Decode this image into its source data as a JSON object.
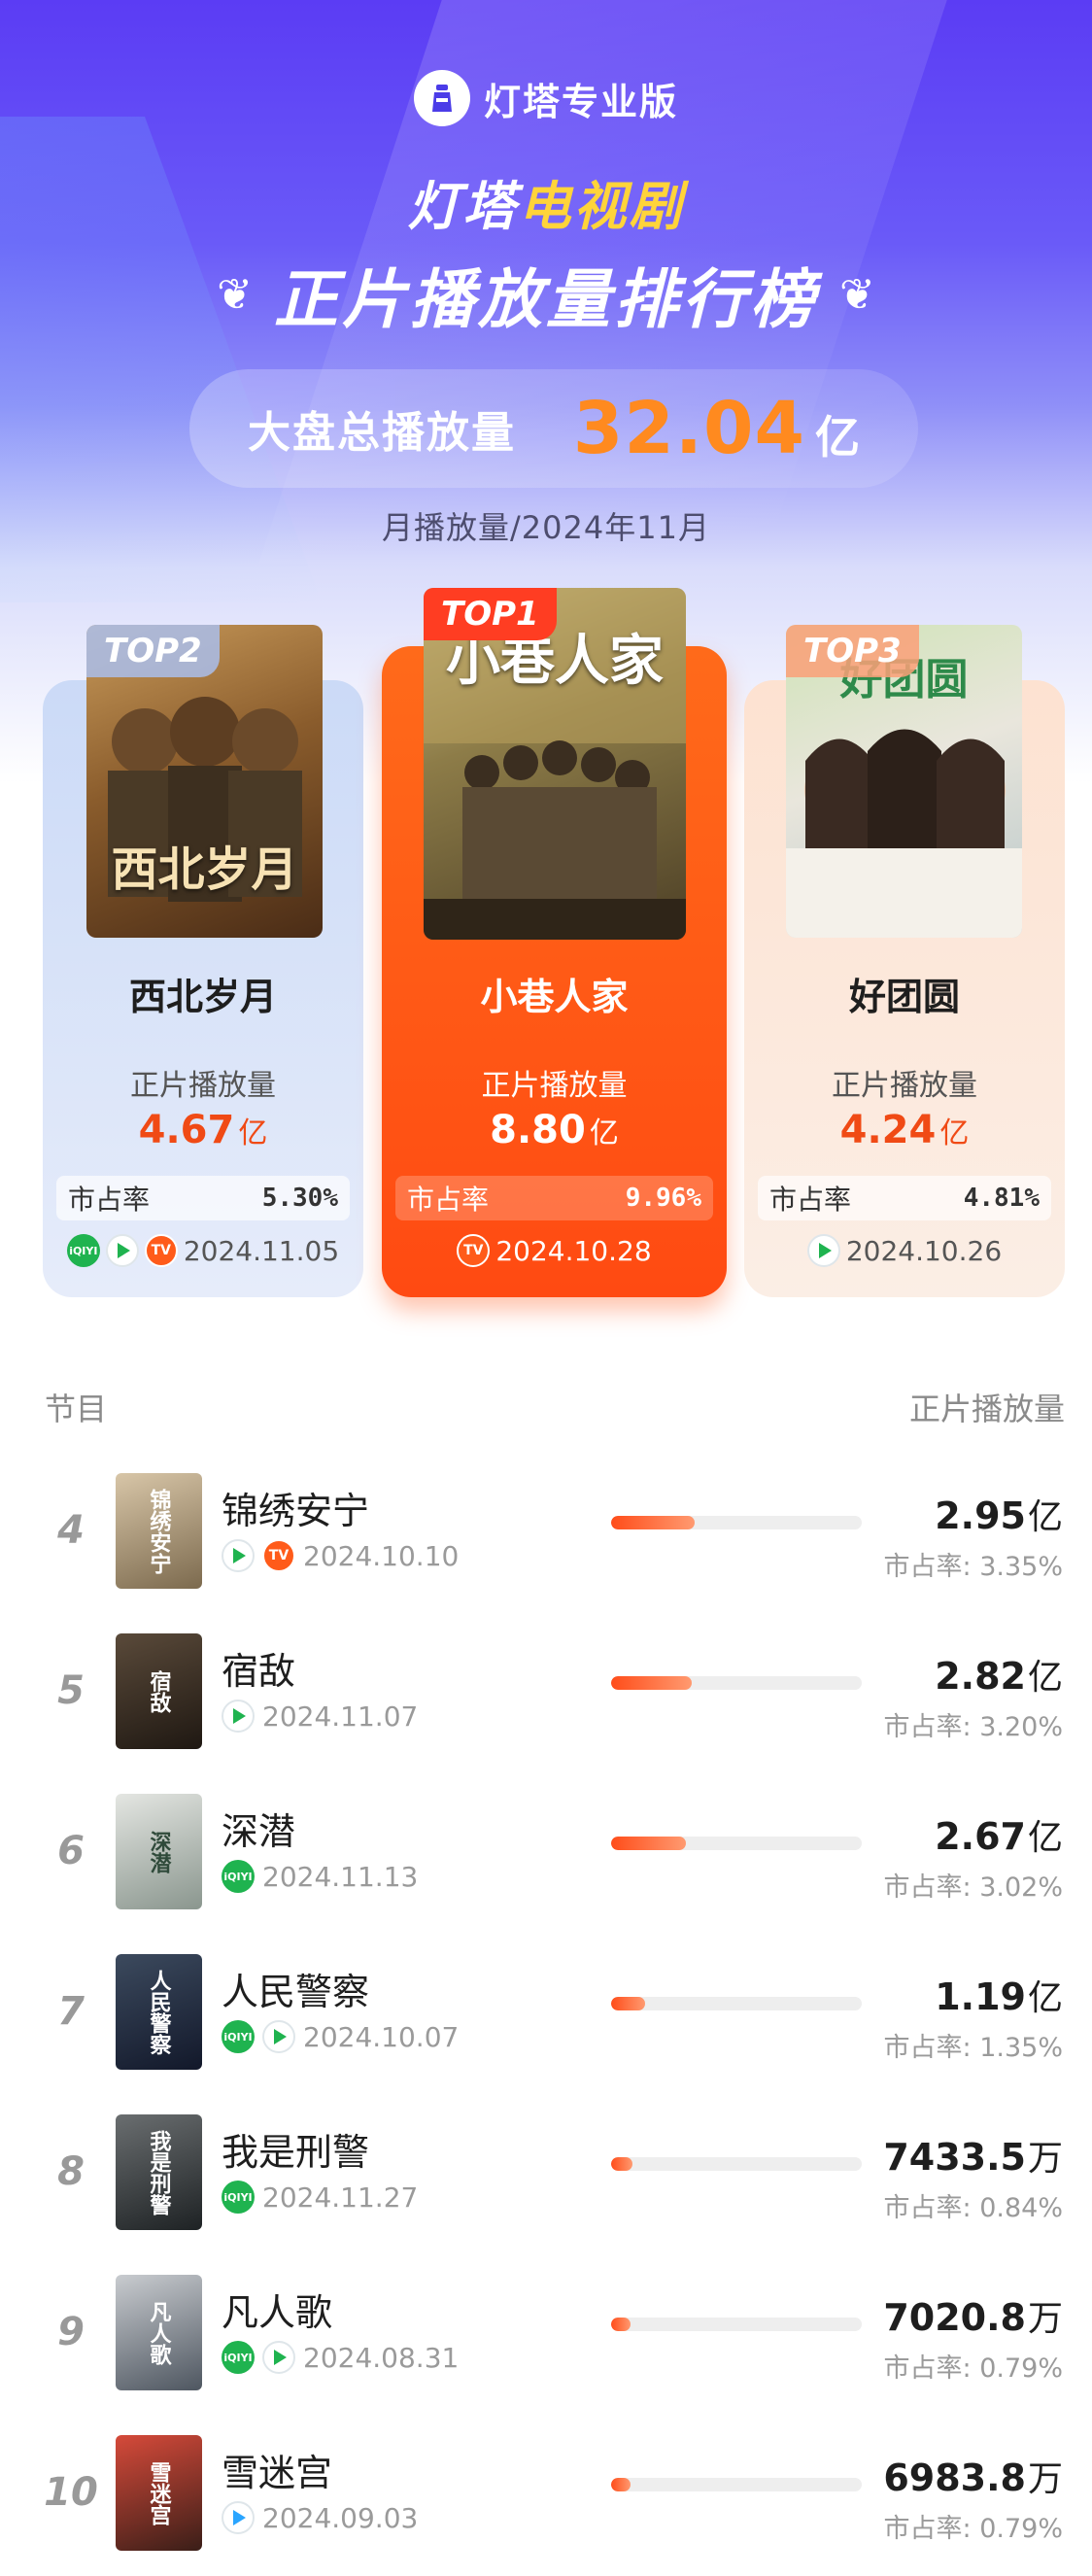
{
  "brand": {
    "name": "灯塔专业版"
  },
  "title": {
    "part1": "灯塔",
    "accent": "电视剧",
    "line2": "正片播放量排行榜"
  },
  "total": {
    "label": "大盘总播放量",
    "value": "32.04",
    "unit": "亿"
  },
  "subtitle": "月播放量/2024年11月",
  "top3": [
    {
      "badge": "TOP2",
      "name": "西北岁月",
      "poster_text": "西北岁月",
      "metric_label": "正片播放量",
      "value": "4.67",
      "unit": "亿",
      "share_label": "市占率",
      "share": "5.30%",
      "platforms": [
        "iqiyi",
        "tencent",
        "mgtv"
      ],
      "date": "2024.11.05"
    },
    {
      "badge": "TOP1",
      "name": "小巷人家",
      "poster_text": "小巷人家",
      "metric_label": "正片播放量",
      "value": "8.80",
      "unit": "亿",
      "share_label": "市占率",
      "share": "9.96%",
      "platforms": [
        "mgtv"
      ],
      "date": "2024.10.28"
    },
    {
      "badge": "TOP3",
      "name": "好团圆",
      "poster_text": "好团圆",
      "metric_label": "正片播放量",
      "value": "4.24",
      "unit": "亿",
      "share_label": "市占率",
      "share": "4.81%",
      "platforms": [
        "tencent"
      ],
      "date": "2024.10.26"
    }
  ],
  "list": {
    "col_program": "节目",
    "col_metric": "正片播放量",
    "rows": [
      {
        "rank": "4",
        "name": "锦绣安宁",
        "thumb_text": "锦绣安宁",
        "platforms": [
          "tencent",
          "mgtv"
        ],
        "date": "2024.10.10",
        "value": "2.95",
        "unit": "亿",
        "share": "市占率: 3.35%",
        "bar": 0.335
      },
      {
        "rank": "5",
        "name": "宿敌",
        "thumb_text": "宿敌",
        "platforms": [
          "tencent"
        ],
        "date": "2024.11.07",
        "value": "2.82",
        "unit": "亿",
        "share": "市占率: 3.20%",
        "bar": 0.32
      },
      {
        "rank": "6",
        "name": "深潜",
        "thumb_text": "深潜",
        "platforms": [
          "iqiyi"
        ],
        "date": "2024.11.13",
        "value": "2.67",
        "unit": "亿",
        "share": "市占率: 3.02%",
        "bar": 0.3
      },
      {
        "rank": "7",
        "name": "人民警察",
        "thumb_text": "人民警察",
        "platforms": [
          "iqiyi",
          "tencent"
        ],
        "date": "2024.10.07",
        "value": "1.19",
        "unit": "亿",
        "share": "市占率: 1.35%",
        "bar": 0.135
      },
      {
        "rank": "8",
        "name": "我是刑警",
        "thumb_text": "我是刑警",
        "platforms": [
          "iqiyi"
        ],
        "date": "2024.11.27",
        "value": "7433.5",
        "unit": "万",
        "share": "市占率: 0.84%",
        "bar": 0.084
      },
      {
        "rank": "9",
        "name": "凡人歌",
        "thumb_text": "凡人歌",
        "platforms": [
          "iqiyi",
          "tencent"
        ],
        "date": "2024.08.31",
        "value": "7020.8",
        "unit": "万",
        "share": "市占率: 0.79%",
        "bar": 0.079
      },
      {
        "rank": "10",
        "name": "雪迷宫",
        "thumb_text": "雪迷宫",
        "platforms": [
          "youku"
        ],
        "date": "2024.09.03",
        "value": "6983.8",
        "unit": "万",
        "share": "市占率: 0.79%",
        "bar": 0.079
      }
    ]
  },
  "colors": {
    "accent": "#ff4a12",
    "header": "#5b3cf4",
    "highlight": "#ffd43a",
    "value": "#f04a15"
  }
}
